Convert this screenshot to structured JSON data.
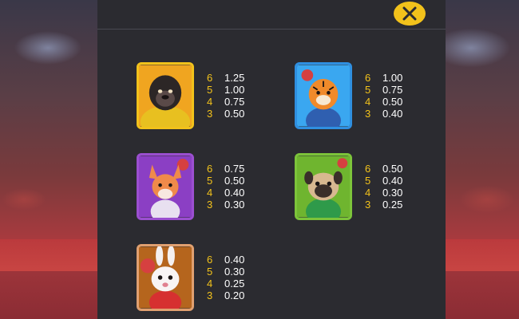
{
  "colors": {
    "panel": "#2b2b30",
    "accent": "#f2c21b",
    "value_text": "#ffffff"
  },
  "close_button": {
    "icon": "close-icon"
  },
  "symbols": [
    {
      "name": "gorilla",
      "frame_color": "#f2c21b",
      "bg_color": "#f0a520",
      "pays": [
        {
          "count": "6",
          "value": "1.25"
        },
        {
          "count": "5",
          "value": "1.00"
        },
        {
          "count": "4",
          "value": "0.75"
        },
        {
          "count": "3",
          "value": "0.50"
        }
      ]
    },
    {
      "name": "tiger",
      "frame_color": "#2f8fe0",
      "bg_color": "#3aa7f0",
      "pays": [
        {
          "count": "6",
          "value": "1.00"
        },
        {
          "count": "5",
          "value": "0.75"
        },
        {
          "count": "4",
          "value": "0.50"
        },
        {
          "count": "3",
          "value": "0.40"
        }
      ]
    },
    {
      "name": "fox",
      "frame_color": "#9b4fd0",
      "bg_color": "#8b3fc4",
      "pays": [
        {
          "count": "6",
          "value": "0.75"
        },
        {
          "count": "5",
          "value": "0.50"
        },
        {
          "count": "4",
          "value": "0.40"
        },
        {
          "count": "3",
          "value": "0.30"
        }
      ]
    },
    {
      "name": "pug",
      "frame_color": "#7cc43a",
      "bg_color": "#6fb52f",
      "pays": [
        {
          "count": "6",
          "value": "0.50"
        },
        {
          "count": "5",
          "value": "0.40"
        },
        {
          "count": "4",
          "value": "0.30"
        },
        {
          "count": "3",
          "value": "0.25"
        }
      ]
    },
    {
      "name": "rabbit",
      "frame_color": "#e0a070",
      "bg_color": "#b5651d",
      "pays": [
        {
          "count": "6",
          "value": "0.40"
        },
        {
          "count": "5",
          "value": "0.30"
        },
        {
          "count": "4",
          "value": "0.25"
        },
        {
          "count": "3",
          "value": "0.20"
        }
      ]
    }
  ]
}
